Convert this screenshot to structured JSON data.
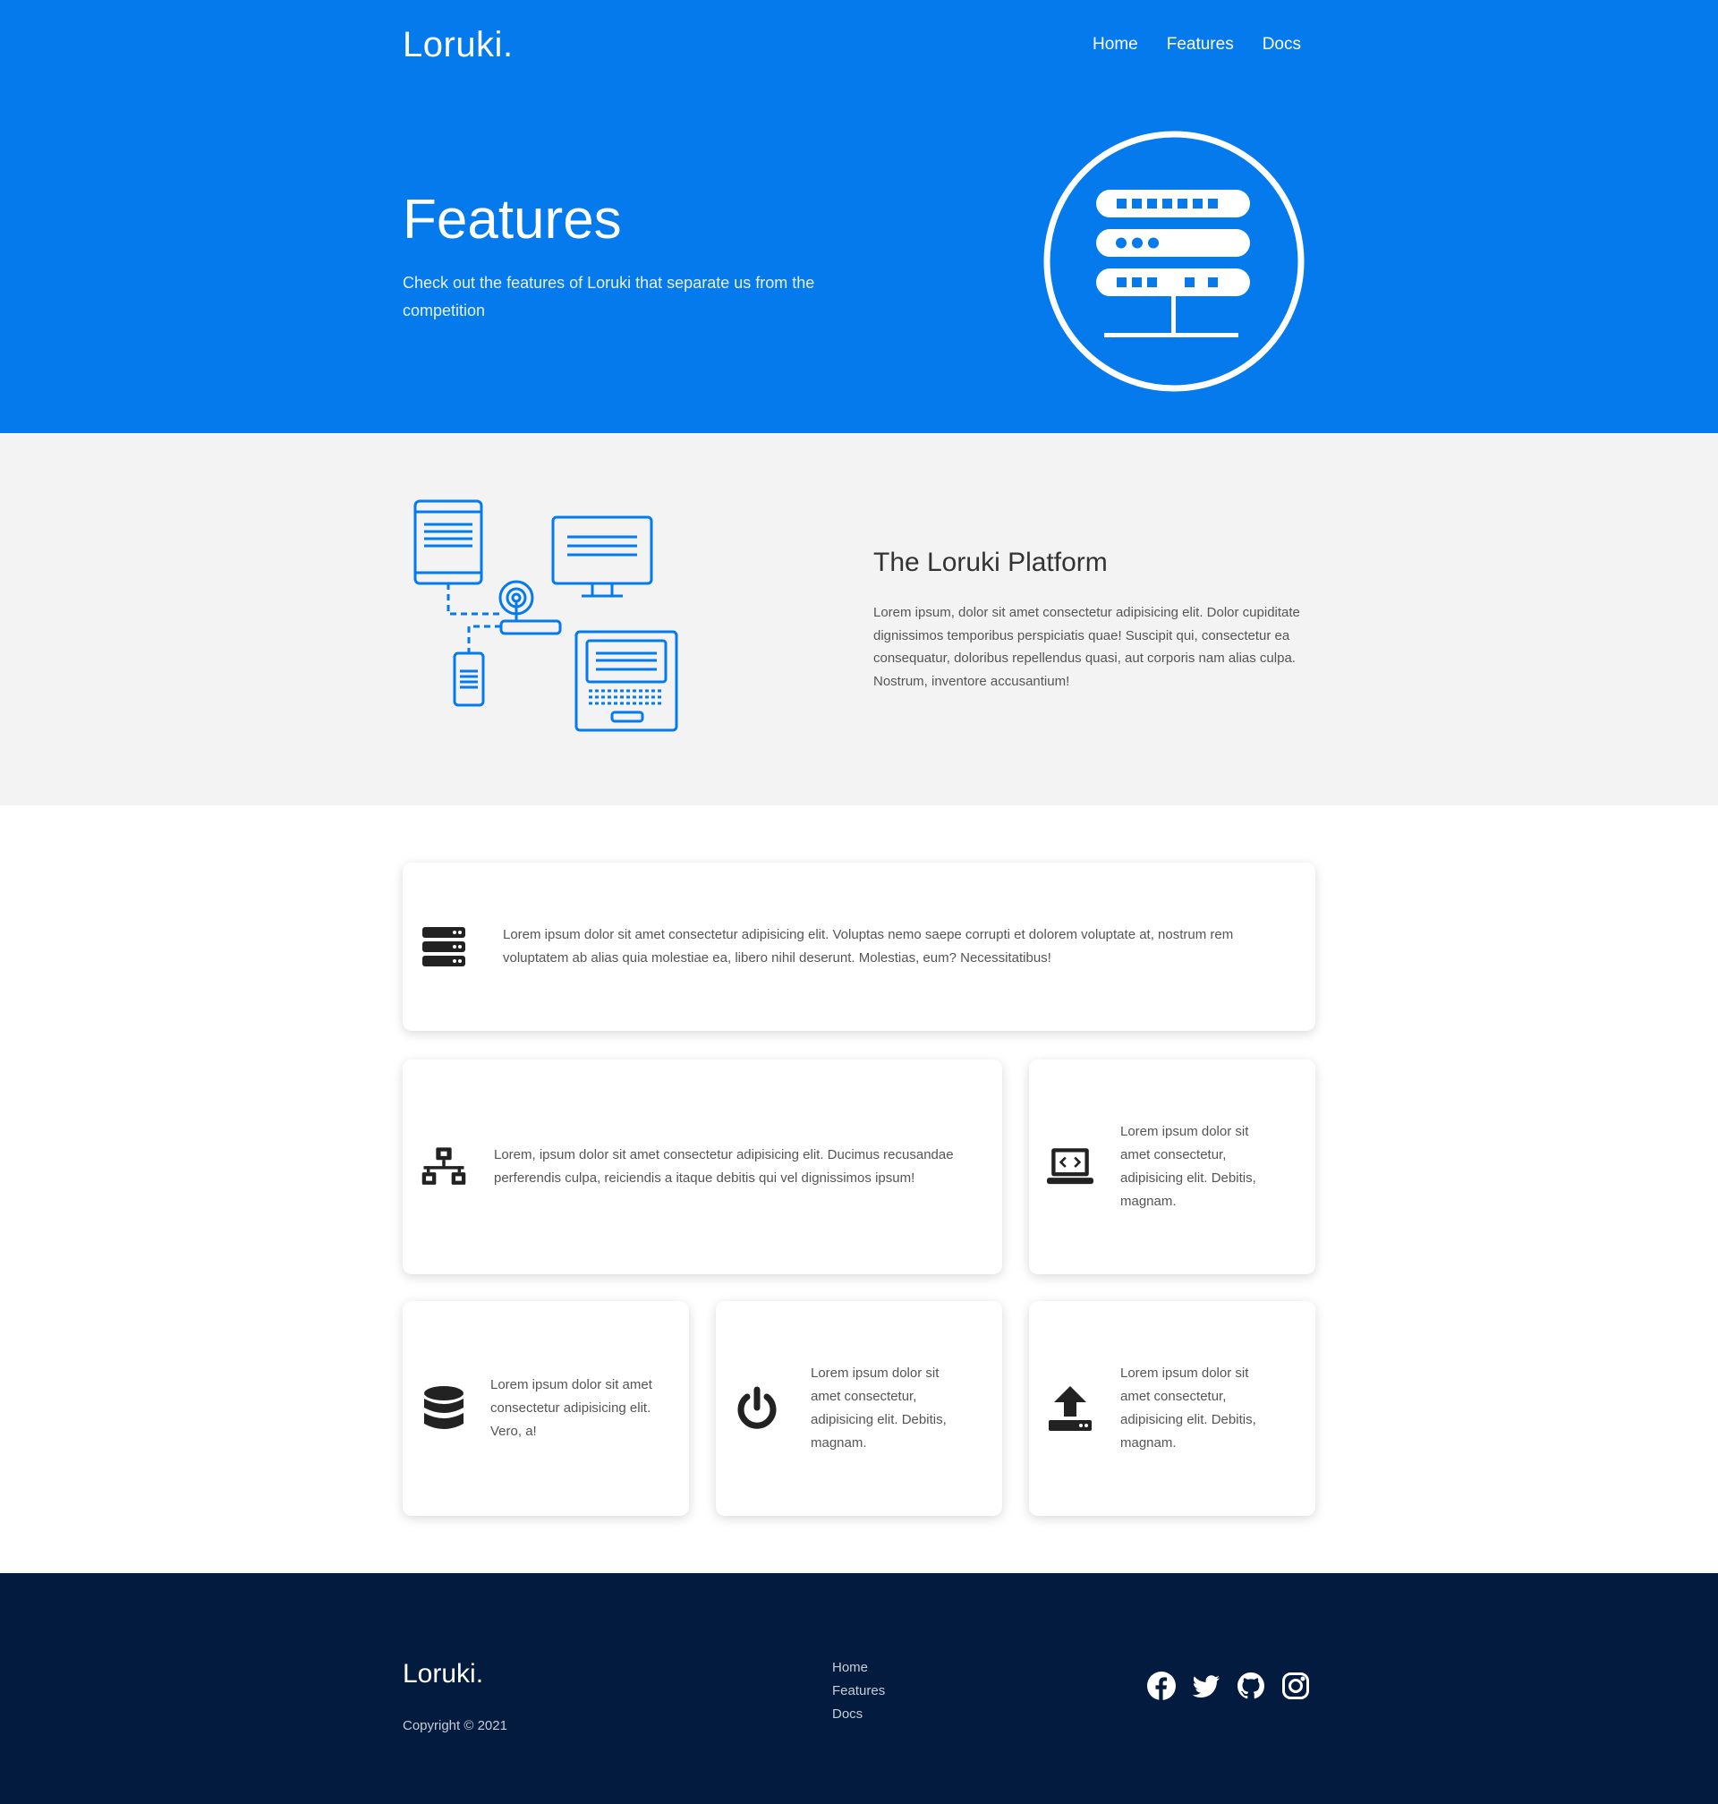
{
  "brand": {
    "name": "Loruki."
  },
  "nav": {
    "items": [
      "Home",
      "Features",
      "Docs"
    ]
  },
  "hero": {
    "title": "Features",
    "subtitle": "Check out the features of Loruki that separate us from the competition",
    "icon": "server-icon"
  },
  "platform": {
    "title": "The Loruki Platform",
    "description": "Lorem ipsum, dolor sit amet consectetur adipisicing elit. Dolor cupiditate dignissimos temporibus perspiciatis quae! Suscipit qui, consectetur ea consequatur, doloribus repellendus quasi, aut corporis nam alias culpa. Nostrum, inventore accusantium!",
    "icon": "connected-devices-icon"
  },
  "cards": [
    {
      "icon": "server-icon",
      "text": "Lorem ipsum dolor sit amet consectetur adipisicing elit. Voluptas nemo saepe corrupti et dolorem voluptate at, nostrum rem voluptatem ab alias quia molestiae ea, libero nihil deserunt. Molestias, eum? Necessitatibus!"
    },
    {
      "icon": "network-wired-icon",
      "text": "Lorem, ipsum dolor sit amet consectetur adipisicing elit. Ducimus recusandae perferendis culpa, reiciendis a itaque debitis qui vel dignissimos ipsum!"
    },
    {
      "icon": "laptop-code-icon",
      "text": "Lorem ipsum dolor sit amet consectetur, adipisicing elit. Debitis, magnam."
    },
    {
      "icon": "database-icon",
      "text": "Lorem ipsum dolor sit amet consectetur adipisicing elit. Vero, a!"
    },
    {
      "icon": "power-off-icon",
      "text": "Lorem ipsum dolor sit amet consectetur, adipisicing elit. Debitis, magnam."
    },
    {
      "icon": "upload-icon",
      "text": "Lorem ipsum dolor sit amet consectetur, adipisicing elit. Debitis, magnam."
    }
  ],
  "footer": {
    "logo": "Loruki.",
    "copyright": "Copyright © 2021",
    "links": [
      "Home",
      "Features",
      "Docs"
    ],
    "social": [
      "facebook-icon",
      "twitter-icon",
      "github-icon",
      "instagram-icon"
    ]
  },
  "colors": {
    "primary": "#047aed",
    "dark": "#031b3e",
    "light": "#f3f3f3"
  }
}
